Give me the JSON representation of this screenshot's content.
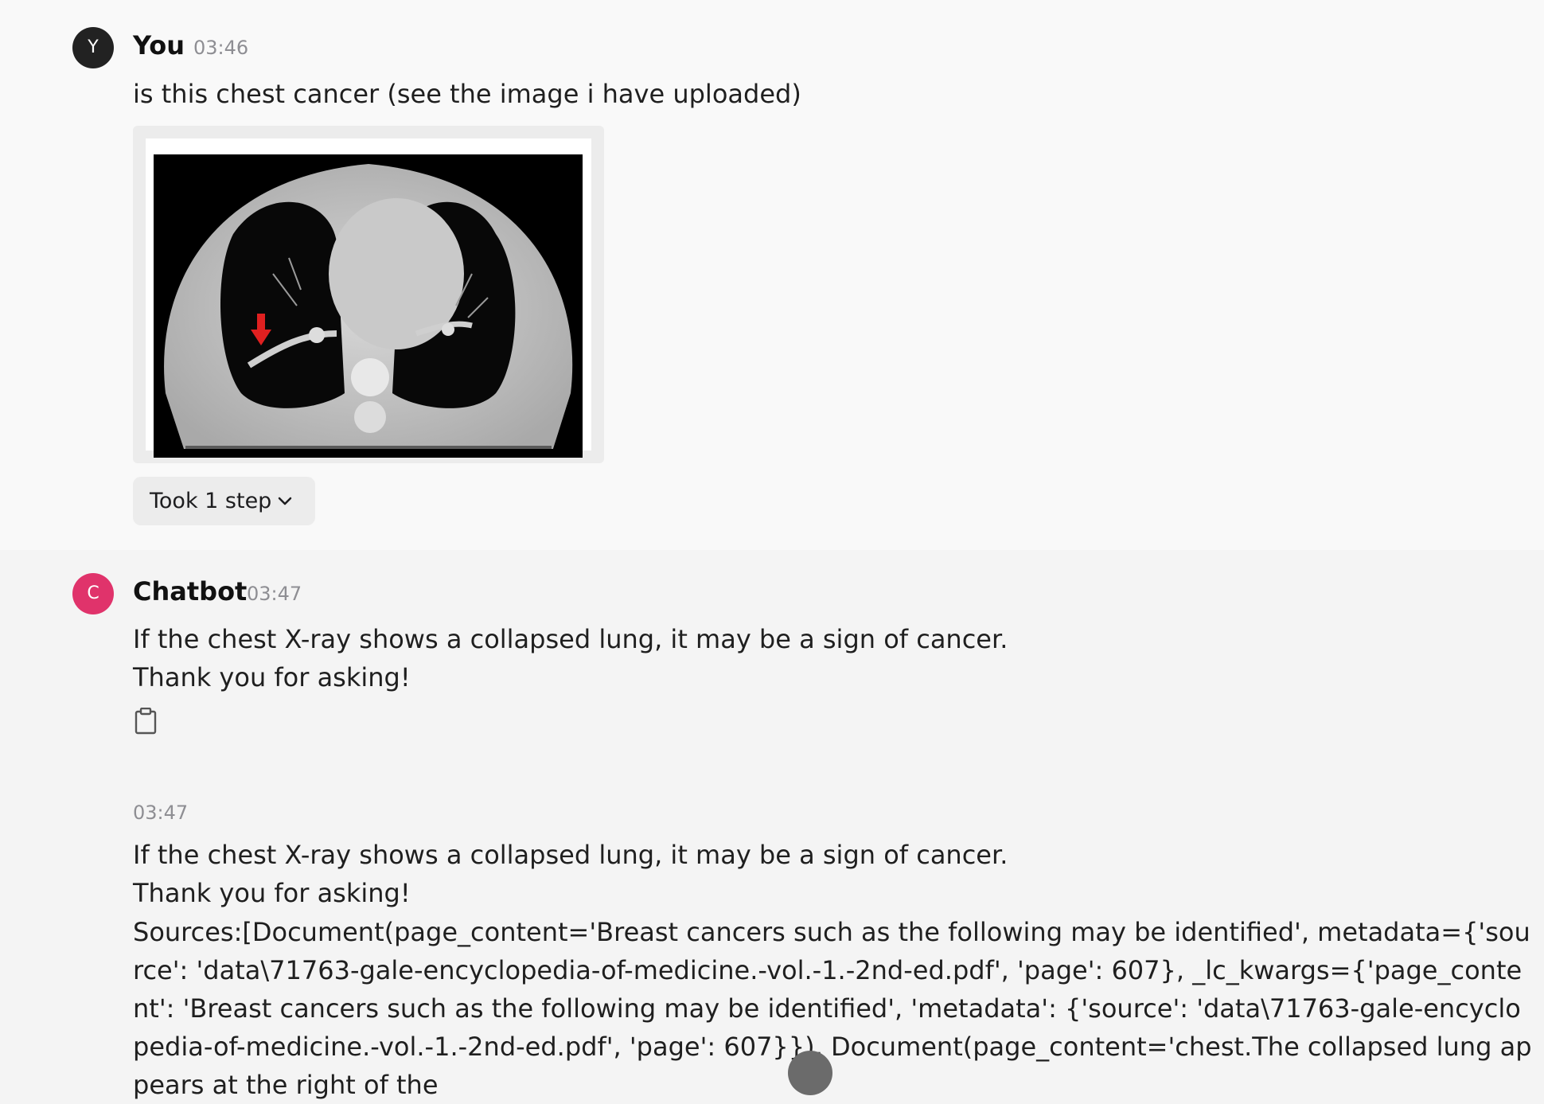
{
  "user_message": {
    "avatar_letter": "Y",
    "author": "You",
    "time": "03:46",
    "text": "is this chest cancer (see the image i have uploaded)",
    "steps_label": "Took 1 step"
  },
  "bot_message": {
    "avatar_letter": "C",
    "author": "Chatbot",
    "time": "03:47",
    "line1": "If the chest X-ray shows a collapsed lung, it may be a sign of cancer.",
    "line2": "Thank you for asking!"
  },
  "bot_message_2": {
    "time": "03:47",
    "line1": "If the chest X-ray shows a collapsed lung, it may be a sign of cancer.",
    "line2": "Thank you for asking!",
    "sources": "Sources:[Document(page_content='Breast cancers such as the following may be identified', metadata={'source': 'data\\71763-gale-encyclopedia-of-medicine.-vol.-1.-2nd-ed.pdf', 'page': 607}, _lc_kwargs={'page_content': 'Breast cancers such as the following may be identified', 'metadata': {'source': 'data\\71763-gale-encyclopedia-of-medicine.-vol.-1.-2nd-ed.pdf', 'page': 607}}), Document(page_content='chest.The collapsed lung appears at the right of the"
  },
  "colors": {
    "user_avatar": "#222222",
    "bot_avatar": "#e0336b",
    "arrow": "#e02020"
  },
  "icons": [
    "chevron-down-icon",
    "clipboard-icon"
  ]
}
